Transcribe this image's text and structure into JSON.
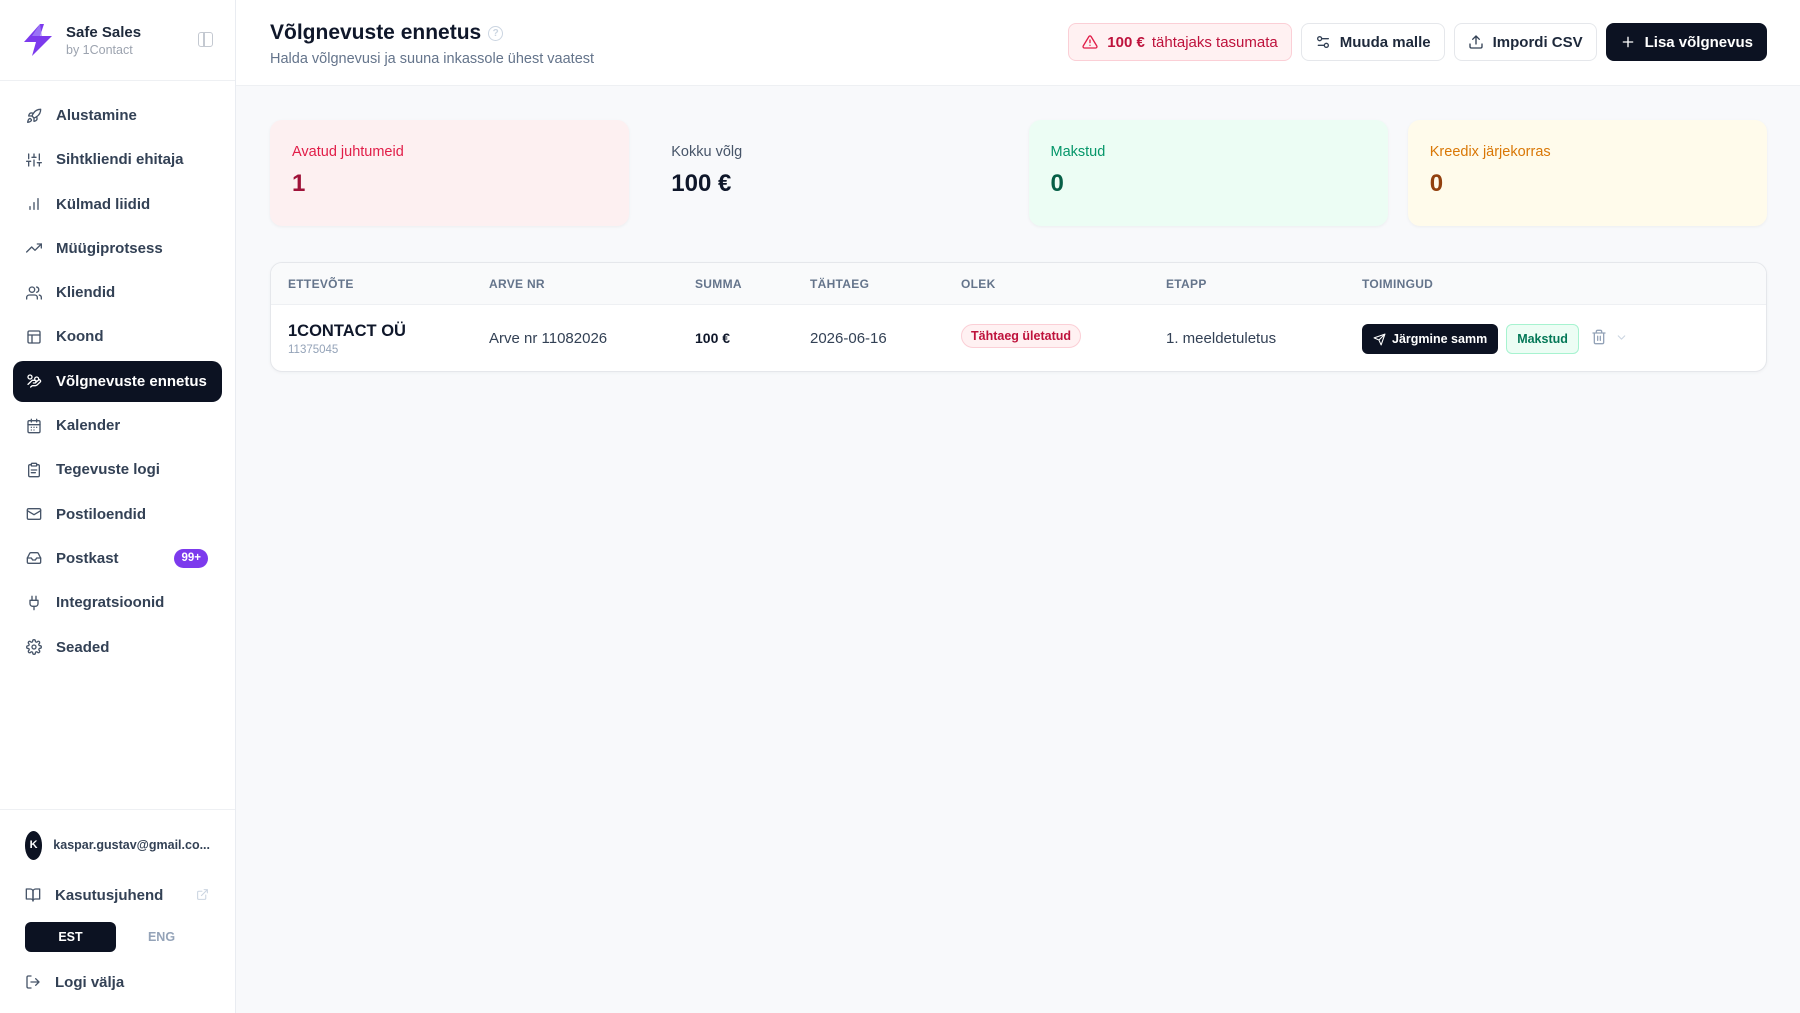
{
  "brand": {
    "name": "Safe Sales",
    "sub": "by 1Contact",
    "accent": "#7c3aed"
  },
  "nav": [
    {
      "label": "Alustamine",
      "icon": "rocket-icon"
    },
    {
      "label": "Sihtkliendi ehitaja",
      "icon": "sliders-icon"
    },
    {
      "label": "Külmad liidid",
      "icon": "bar-chart-icon"
    },
    {
      "label": "Müügiprotsess",
      "icon": "trending-up-icon"
    },
    {
      "label": "Kliendid",
      "icon": "users-icon"
    },
    {
      "label": "Koond",
      "icon": "table-icon"
    },
    {
      "label": "Võlgnevuste ennetus",
      "icon": "hand-coins-icon",
      "active": true
    },
    {
      "label": "Kalender",
      "icon": "calendar-icon"
    },
    {
      "label": "Tegevuste logi",
      "icon": "clipboard-icon"
    },
    {
      "label": "Postiloendid",
      "icon": "mail-icon"
    },
    {
      "label": "Postkast",
      "icon": "inbox-icon",
      "badge": "99+"
    },
    {
      "label": "Integratsioonid",
      "icon": "plug-icon"
    },
    {
      "label": "Seaded",
      "icon": "gear-icon"
    }
  ],
  "user": {
    "initial": "K",
    "email": "kaspar.gustav@gmail.co..."
  },
  "guide_label": "Kasutusjuhend",
  "lang": {
    "est": "EST",
    "eng": "ENG",
    "active": "EST"
  },
  "logout_label": "Logi välja",
  "header": {
    "title": "Võlgnevuste ennetus",
    "help": "?",
    "subtitle": "Halda võlgnevusi ja suuna inkassole ühest vaatest",
    "overdue_amount": "100 €",
    "overdue_text": "tähtajaks tasumata",
    "edit_templates": "Muuda malle",
    "import_csv": "Impordi CSV",
    "add_debt": "Lisa võlgnevus"
  },
  "stats": [
    {
      "label": "Avatud juhtumeid",
      "value": "1"
    },
    {
      "label": "Kokku võlg",
      "value": "100 €"
    },
    {
      "label": "Makstud",
      "value": "0"
    },
    {
      "label": "Kreedix järjekorras",
      "value": "0"
    }
  ],
  "table": {
    "columns": [
      "ETTEVÕTE",
      "ARVE NR",
      "SUMMA",
      "TÄHTAEG",
      "OLEK",
      "ETAPP",
      "TOIMINGUD"
    ],
    "rows": [
      {
        "company": "1CONTACT OÜ",
        "reg": "11375045",
        "invoice": "Arve nr 11082026",
        "amount": "100 €",
        "due": "2026-06-16",
        "status": "Tähtaeg ületatud",
        "stage": "1. meeldetuletus",
        "next": "Järgmine samm",
        "paid": "Makstud"
      }
    ]
  }
}
